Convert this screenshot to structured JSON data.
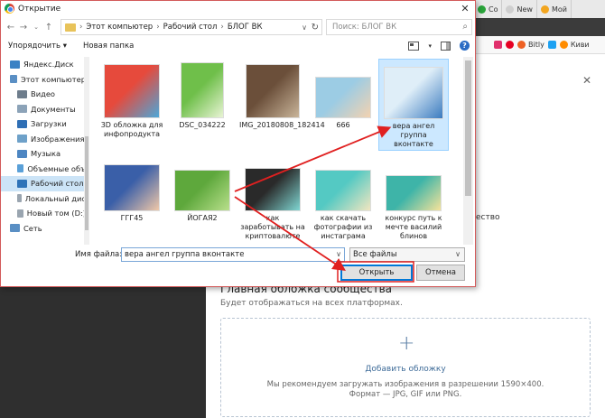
{
  "browser": {
    "tabs": [
      {
        "label": "Co",
        "color": "#2aa53a"
      },
      {
        "label": "New",
        "color": "#cfcfcf"
      },
      {
        "label": "Мой",
        "color": "#f2a51f"
      }
    ],
    "bookmarks": [
      {
        "label": "",
        "color": "#e1306c"
      },
      {
        "label": "",
        "color": "#e60023"
      },
      {
        "label": "Bitly",
        "color": "#ee6123"
      },
      {
        "label": "",
        "color": "#1da1f2"
      },
      {
        "label": "Киви",
        "color": "#ff8c00"
      }
    ],
    "partial_text": "ество",
    "section_title": "Главная обложка сообщества",
    "section_subtitle": "Будет отображаться на всех платформах.",
    "upload_label": "Добавить обложку",
    "upload_hint_line1": "Мы рекомендуем загружать изображения в разрешении 1590×400.",
    "upload_hint_line2": "Формат — JPG, GIF или PNG."
  },
  "dialog": {
    "title": "Открытие",
    "breadcrumbs": [
      "Этот компьютер",
      "Рабочий стол",
      "БЛОГ ВК"
    ],
    "search_placeholder": "Поиск: БЛОГ ВК",
    "toolbar": {
      "organize": "Упорядочить ▾",
      "new_folder": "Новая папка"
    },
    "sidebar": [
      {
        "label": "Яндекс.Диск",
        "color": "#3b82c4",
        "selected": false
      },
      {
        "label": "Этот компьютер",
        "color": "#5a8fc4",
        "selected": false
      },
      {
        "label": "Видео",
        "color": "#6e7d8c",
        "selected": false
      },
      {
        "label": "Документы",
        "color": "#8ca3b8",
        "selected": false
      },
      {
        "label": "Загрузки",
        "color": "#2f6fb5",
        "selected": false
      },
      {
        "label": "Изображения",
        "color": "#6ea1c9",
        "selected": false
      },
      {
        "label": "Музыка",
        "color": "#4d86c2",
        "selected": false
      },
      {
        "label": "Объемные объ",
        "color": "#5aa0d8",
        "selected": false
      },
      {
        "label": "Рабочий стол",
        "color": "#2e73b8",
        "selected": true
      },
      {
        "label": "Локальный дис",
        "color": "#9aa5b0",
        "selected": false
      },
      {
        "label": "Новый том (D:)",
        "color": "#9aa5b0",
        "selected": false
      },
      {
        "label": "Сеть",
        "color": "#5a8fc4",
        "selected": false
      }
    ],
    "files": [
      {
        "label": "3D обложка для инфопродукта",
        "colors": [
          "#e64a3c",
          "#4ca7d8"
        ],
        "selected": false
      },
      {
        "label": "DSC_034222",
        "colors": [
          "#6fbf4a",
          "#e8f4d4"
        ],
        "selected": false
      },
      {
        "label": "IMG_20180808_182414",
        "colors": [
          "#6b4f3a",
          "#c9b59a"
        ],
        "selected": false
      },
      {
        "label": "666",
        "colors": [
          "#9ccce4",
          "#f3d2b0"
        ],
        "selected": false
      },
      {
        "label": "вера ангел группа вконтакте",
        "colors": [
          "#dfeef8",
          "#3b7bbf"
        ],
        "selected": true
      },
      {
        "label": "ГГГ45",
        "colors": [
          "#3a5fa8",
          "#f0c8a8"
        ],
        "selected": false
      },
      {
        "label": "ЙОГАЯ2",
        "colors": [
          "#5ea83c",
          "#b9e08c"
        ],
        "selected": false
      },
      {
        "label": "как заработывать на криптовалюте",
        "colors": [
          "#2a2a2a",
          "#7fd6d2"
        ],
        "selected": false
      },
      {
        "label": "как скачать фотографии из инстаграма",
        "colors": [
          "#54c9c3",
          "#f1e6c0"
        ],
        "selected": false
      },
      {
        "label": "конкурс путь к мечте василий блинов",
        "colors": [
          "#3eb4a8",
          "#f6e39a"
        ],
        "selected": false
      }
    ],
    "filename_label": "Имя файла:",
    "filename_value": "вера ангел группа вконтакте",
    "filetype_value": "Все файлы",
    "open_button": "Открыть",
    "cancel_button": "Отмена",
    "annotation_color": "#e02020"
  }
}
